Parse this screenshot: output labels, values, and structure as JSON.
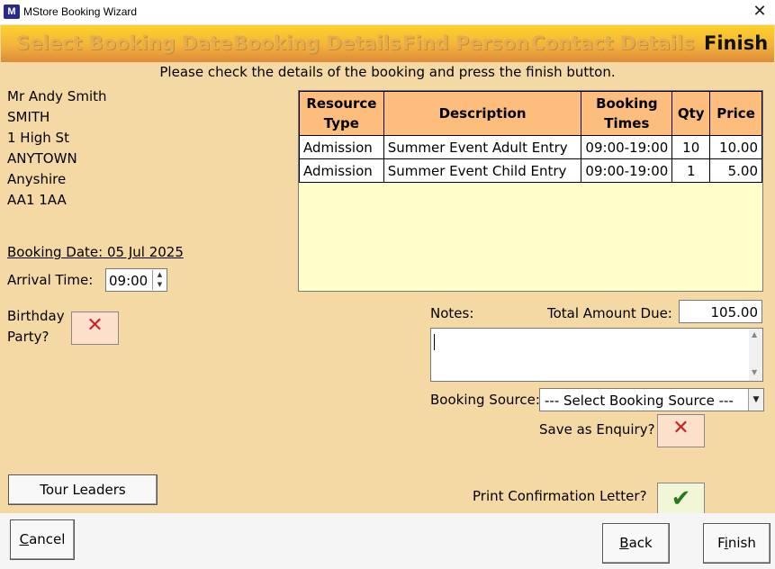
{
  "window": {
    "app_icon": "M",
    "title": "MStore Booking Wizard",
    "close_icon": "✕"
  },
  "steps": [
    {
      "label": "Select Booking Date",
      "active": false
    },
    {
      "label": "Booking Details",
      "active": false
    },
    {
      "label": "Find Person",
      "active": false
    },
    {
      "label": "Contact Details",
      "active": false
    },
    {
      "label": "Finish",
      "active": true
    }
  ],
  "instructions": "Please check the details of the booking and press the finish button.",
  "address": [
    "Mr Andy Smith",
    "SMITH",
    "1 High St",
    "ANYTOWN",
    "Anyshire",
    "AA1 1AA"
  ],
  "booking_date": "Booking Date: 05 Jul 2025",
  "arrival": {
    "label": "Arrival Time:",
    "value": "09:00"
  },
  "birthday": {
    "label_line1": "Birthday",
    "label_line2": "Party?",
    "checked": false
  },
  "table": {
    "headers": {
      "type_1": "Resource",
      "type_2": "Type",
      "description": "Description",
      "times_1": "Booking",
      "times_2": "Times",
      "qty": "Qty",
      "price": "Price"
    },
    "rows": [
      {
        "type": "Admission",
        "description": "Summer Event Adult Entry",
        "times": "09:00-19:00",
        "qty": "10",
        "price": "10.00"
      },
      {
        "type": "Admission",
        "description": "Summer Event Child Entry",
        "times": "09:00-19:00",
        "qty": "1",
        "price": "5.00"
      }
    ]
  },
  "notes": {
    "label": "Notes:",
    "value": ""
  },
  "total": {
    "label": "Total Amount Due:",
    "value": "105.00"
  },
  "booking_source": {
    "label": "Booking Source:",
    "selected": "--- Select Booking Source ---"
  },
  "save_enquiry": {
    "label": "Save as Enquiry?",
    "checked": false
  },
  "print_letter": {
    "label": "Print Confirmation Letter?",
    "checked": true
  },
  "buttons": {
    "tour_leaders": "Tour Leaders",
    "cancel_first": "C",
    "cancel_rest": "ancel",
    "back_first": "B",
    "back_rest": "ack",
    "finish_pre": "F",
    "finish_u": "i",
    "finish_post": "nish"
  },
  "icons": {
    "cross": "✕",
    "tick": "✔"
  },
  "colors": {
    "background": "#f5d9a4",
    "header_bar": "#f3b43a",
    "grid_background": "#ffffcc",
    "table_header": "#fdbd7c"
  }
}
